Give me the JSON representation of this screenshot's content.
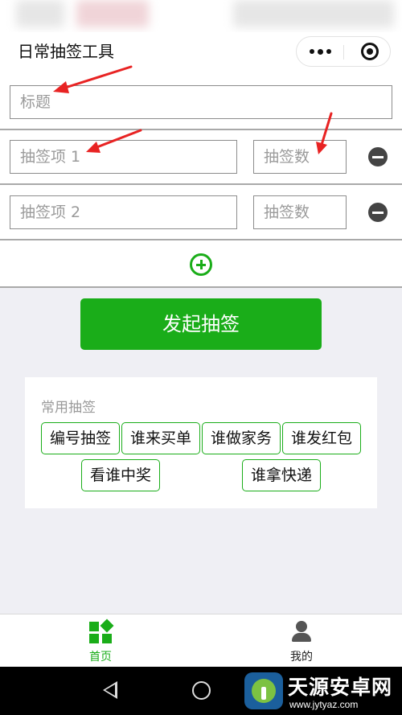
{
  "nav": {
    "title": "日常抽签工具",
    "menu_icon": "more-dots-icon",
    "close_icon": "target-circle-icon"
  },
  "form": {
    "title_placeholder": "标题",
    "items": [
      {
        "name_placeholder": "抽签项 1",
        "count_placeholder": "抽签数"
      },
      {
        "name_placeholder": "抽签项 2",
        "count_placeholder": "抽签数"
      }
    ],
    "remove_icon": "minus-circle-icon",
    "add_icon": "plus-circle-icon"
  },
  "start_button": "发起抽签",
  "presets": {
    "label": "常用抽签",
    "items": [
      "编号抽签",
      "谁来买单",
      "谁做家务",
      "谁发红包",
      "看谁中奖",
      "谁拿快递"
    ]
  },
  "tabbar": {
    "tabs": [
      {
        "label": "首页",
        "icon": "home-blocks-icon",
        "active": true
      },
      {
        "label": "我的",
        "icon": "user-icon",
        "active": false
      }
    ]
  },
  "watermark": {
    "title": "天源安卓网",
    "url": "www.jytyaz.com"
  },
  "colors": {
    "accent": "#1aad19",
    "annotation": "#e82323",
    "page_bg": "#efeff4",
    "system_nav": "#000000"
  }
}
